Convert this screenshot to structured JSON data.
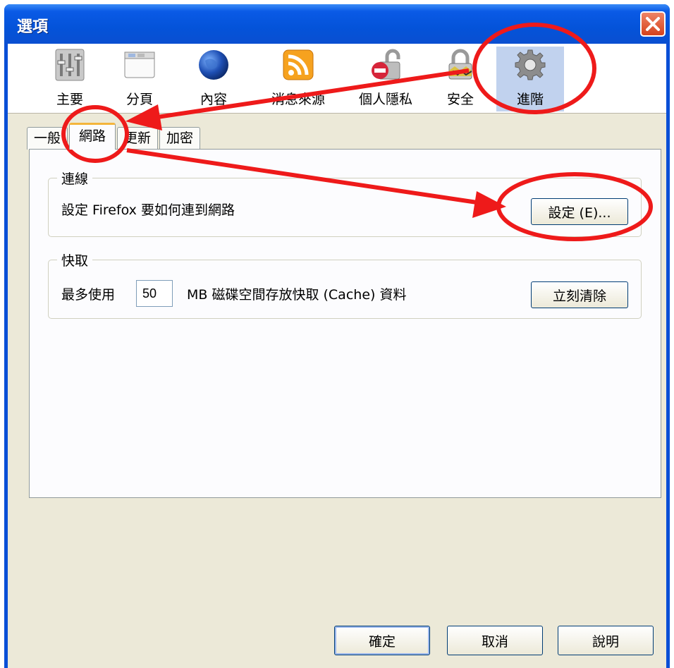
{
  "window": {
    "title": "選項"
  },
  "toolbar": {
    "panes": [
      {
        "label": "主要",
        "icon": "main-settings-icon"
      },
      {
        "label": "分頁",
        "icon": "tabs-window-icon"
      },
      {
        "label": "內容",
        "icon": "content-globe-icon"
      },
      {
        "label": "消息來源",
        "icon": "rss-feed-icon"
      },
      {
        "label": "個人隱私",
        "icon": "privacy-lock-icon"
      },
      {
        "label": "安全",
        "icon": "security-lock-icon"
      },
      {
        "label": "進階",
        "icon": "gear-icon",
        "selected": true
      }
    ]
  },
  "tabs": [
    {
      "label": "一般"
    },
    {
      "label": "網路",
      "selected": true
    },
    {
      "label": "更新"
    },
    {
      "label": "加密"
    }
  ],
  "connection": {
    "caption": "連線",
    "description": "設定 Firefox 要如何連到網路",
    "settings_button": "設定 (E)..."
  },
  "cache": {
    "caption": "快取",
    "prefix": "最多使用",
    "size_value": "50",
    "suffix": "MB 磁碟空間存放快取 (Cache) 資料",
    "clear_button": "立刻清除"
  },
  "footer": {
    "ok": "確定",
    "cancel": "取消",
    "help": "說明"
  },
  "colors": {
    "titlebar": "#0a4fd6",
    "annotation": "#ee1a1a",
    "selected_pane": "#c1d2ee",
    "active_tab_accent": "#f4b53c"
  }
}
